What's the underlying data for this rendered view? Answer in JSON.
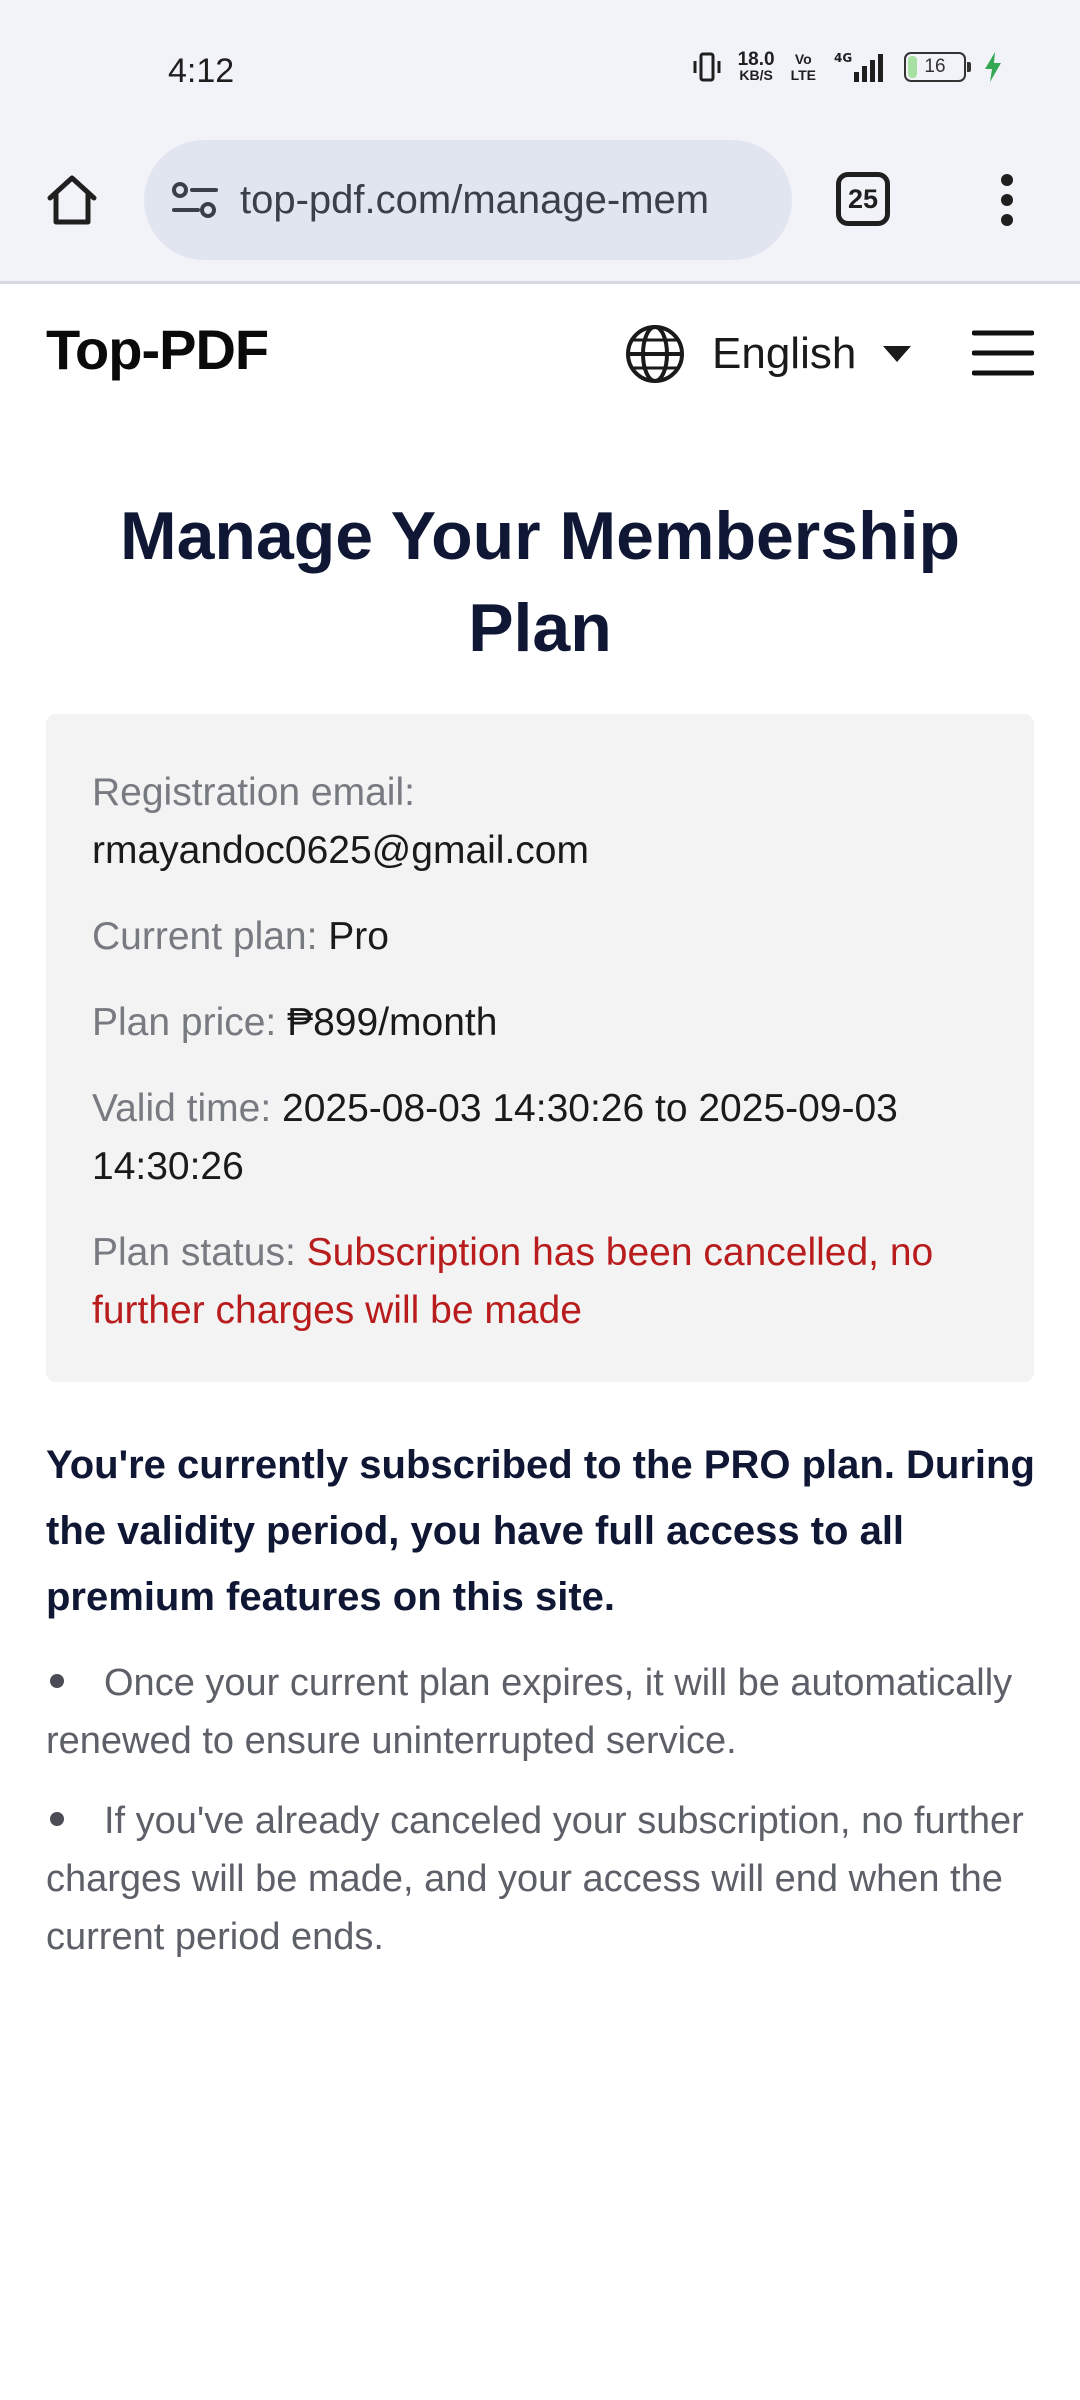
{
  "status_bar": {
    "time": "4:12",
    "net_speed": "18.0",
    "net_unit": "KB/S",
    "volte_top": "Vo",
    "volte_bottom": "LTE",
    "network": "4G",
    "battery": "16",
    "battery_color": "#a7e0a3",
    "charging_color": "#34a853"
  },
  "browser": {
    "url": "top-pdf.com/manage-mem",
    "tab_count": "25"
  },
  "header": {
    "logo": "Top-PDF",
    "language": "English"
  },
  "main": {
    "title": "Manage Your Membership Plan",
    "card": {
      "email_label": "Registration email:",
      "email_value": "rmayandoc0625@gmail.com",
      "plan_label": "Current plan:",
      "plan_value": "Pro",
      "price_label": "Plan price:",
      "price_value": "₱899/month",
      "valid_label": "Valid time:",
      "valid_value": "2025-08-03 14:30:26 to 2025-09-03 14:30:26",
      "status_label": "Plan status:",
      "status_value": "Subscription has been cancelled, no further charges will be made",
      "status_color": "#b91c1c"
    },
    "subscription_note": "You're currently subscribed to the PRO plan. During the validity period, you have full access to all premium features on this site.",
    "bullets": [
      "Once your current plan expires, it will be automatically renewed to ensure uninterrupted service.",
      "If you've already canceled your subscription, no further charges will be made, and your access will end when the current period ends."
    ]
  }
}
